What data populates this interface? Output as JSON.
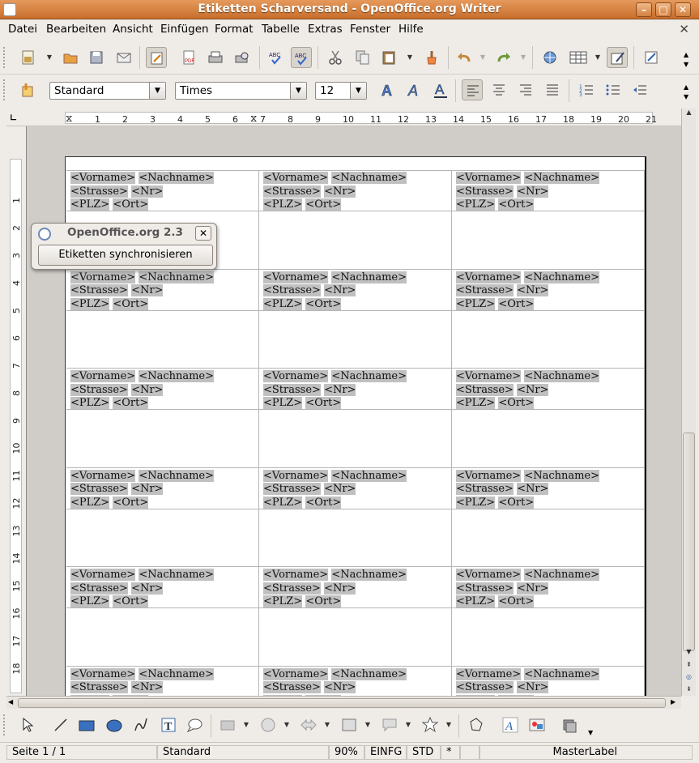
{
  "window": {
    "title": "Etiketten Scharversand - OpenOffice.org Writer"
  },
  "menu": [
    "Datei",
    "Bearbeiten",
    "Ansicht",
    "Einfügen",
    "Format",
    "Tabelle",
    "Extras",
    "Fenster",
    "Hilfe"
  ],
  "format_bar": {
    "style": "Standard",
    "font": "Times",
    "size": "12"
  },
  "ruler": {
    "h": [
      "1",
      "2",
      "3",
      "4",
      "5",
      "6",
      "7",
      "8",
      "9",
      "10",
      "11",
      "12",
      "13",
      "14",
      "15",
      "16",
      "17",
      "18",
      "19",
      "20",
      "21"
    ],
    "v": [
      "1",
      "2",
      "3",
      "4",
      "5",
      "6",
      "7",
      "8",
      "9",
      "10",
      "11",
      "12",
      "13",
      "14",
      "15",
      "16",
      "17",
      "18"
    ]
  },
  "label": {
    "line1a": "<Vorname>",
    "line1b": "<Nachname>",
    "line2a": "<Strasse>",
    "line2b": "<Nr>",
    "line3a": "<PLZ>",
    "line3b": "<Ort>"
  },
  "dialog": {
    "title": "OpenOffice.org 2.3",
    "button": "Etiketten synchronisieren",
    "close": "✕"
  },
  "status": {
    "page": "Seite 1 / 1",
    "style": "Standard",
    "zoom": "90%",
    "mode": "EINFG",
    "sel": "STD",
    "mod": "*",
    "doc": "MasterLabel"
  },
  "colors": {
    "title_bar": "#d97f3c",
    "field_shade": "#c0c0c0"
  }
}
